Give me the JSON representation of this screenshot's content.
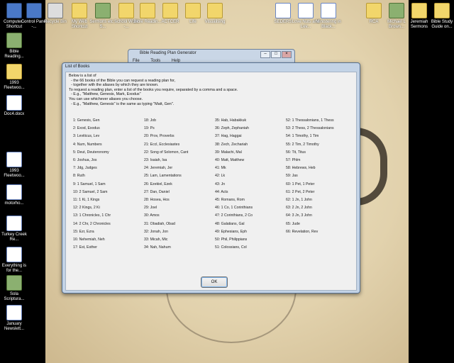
{
  "desktop": {
    "icons": [
      {
        "id": "computer",
        "label": "Computer - Shortcut",
        "kind": "pc"
      },
      {
        "id": "control-panel",
        "label": "Control Panel -...",
        "kind": "pc"
      },
      {
        "id": "recycle-bin",
        "label": "Recycle Bin",
        "kind": "app"
      },
      {
        "id": "my-web",
        "label": "My Web Shortcut",
        "kind": "folder"
      },
      {
        "id": "sermons",
        "label": "Sermons etc - S...",
        "kind": "img"
      },
      {
        "id": "school-work",
        "label": "School Work -...",
        "kind": "folder"
      },
      {
        "id": "bible-reading-top",
        "label": "Bible Readin...",
        "kind": "folder"
      },
      {
        "id": "actcer",
        "label": "ACTCER",
        "kind": "folder"
      },
      {
        "id": "life",
        "label": "Life",
        "kind": "folder"
      },
      {
        "id": "visualising",
        "label": "Visualising",
        "kind": "folder"
      },
      {
        "id": "seders",
        "label": "SEDERS",
        "kind": "mp3"
      },
      {
        "id": "love-nuts",
        "label": "Love Nuts and Lev...",
        "kind": "doc"
      },
      {
        "id": "ministering",
        "label": "Ministering in Black...",
        "kind": "mp3"
      },
      {
        "id": "rca",
        "label": "RCA",
        "kind": "folder"
      },
      {
        "id": "michael",
        "label": "Michael L Brown...",
        "kind": "img"
      },
      {
        "id": "jeremiah",
        "label": "Jeremiah Sermons",
        "kind": "folder"
      },
      {
        "id": "bible-study",
        "label": "Bible Study Guide on...",
        "kind": "folder"
      },
      {
        "id": "bible-reading-left",
        "label": "Bible Reading...",
        "kind": "img"
      },
      {
        "id": "fleetwood1",
        "label": "1993 Fleetwoo...",
        "kind": "folder"
      },
      {
        "id": "doc4",
        "label": "Doc4.docx",
        "kind": "doc"
      },
      {
        "id": "fleetwood2",
        "label": "1993 Fleetwoo...",
        "kind": "doc"
      },
      {
        "id": "motorho",
        "label": "motorho...",
        "kind": "doc"
      },
      {
        "id": "turkey",
        "label": "Turkey Creek Re...",
        "kind": "mp3"
      },
      {
        "id": "everything",
        "label": "Everything is for the...",
        "kind": "mp3"
      },
      {
        "id": "sola",
        "label": "Sola Scriptura...",
        "kind": "img"
      },
      {
        "id": "january",
        "label": "January Newslett...",
        "kind": "doc"
      }
    ]
  },
  "main_window": {
    "title": "Bible Reading Plan Generator",
    "menu": [
      "File",
      "Tools",
      "Help"
    ],
    "controls": {
      "minimize": "–",
      "maximize": "□",
      "close": "×"
    }
  },
  "dialog": {
    "title": "List of Books",
    "intro": "Below is a list of\n  - the 66 books of the Bible you can request a reading plan for,\n  - together with the aliases by which they are known.\nTo request a reading plan, enter a list of the books you require, separated by a comma and a space.\n  - E.g., \"Matthew, Genesis, Mark, Exodus\"\nYou can use whichever aliases you choose.\n  - E.g., \"Matthew, Genesis\" is the same as typing \"Matt, Gen\".",
    "ok_label": "OK",
    "books": [
      "1: Genesis, Gen",
      "2: Exod, Exodus",
      "3: Leviticus, Lev",
      "4: Num, Numbers",
      "5: Deut, Deuteronomy",
      "6: Joshua, Jos",
      "7: Jdg, Judges",
      "8: Ruth",
      "9: 1 Samuel, 1 Sam",
      "10: 2 Samuel, 2 Sam",
      "11: 1 Ki, 1 Kings",
      "12: 2 Kings, 2 Ki",
      "13: 1 Chronicles, 1 Chr",
      "14: 2 Chr, 2 Chronicles",
      "15: Ezr, Ezra",
      "16: Nehemiah, Neh",
      "17: Est, Esther",
      "18: Job",
      "19: Ps",
      "20: Prov, Proverbs",
      "21: Eccl, Ecclesiastes",
      "22: Song of Solomon, Cant",
      "23: Isaiah, Isa",
      "24: Jeremiah, Jer",
      "25: Lam, Lamentations",
      "26: Ezekiel, Ezek",
      "27: Dan, Daniel",
      "28: Hosea, Hos",
      "29: Joel",
      "30: Amos",
      "31: Obadiah, Obad",
      "32: Jonah, Jon",
      "33: Micah, Mic",
      "34: Nah, Nahum",
      "35: Hab, Habakkuk",
      "36: Zeph, Zephaniah",
      "37: Hag, Haggai",
      "38: Zech, Zechariah",
      "39: Malachi, Mal",
      "40: Matt, Matthew",
      "41: Mk",
      "42: Lk",
      "43: Jn",
      "44: Acts",
      "45: Romans, Rom",
      "46: 1 Co, 1 Corinthians",
      "47: 2 Corinthians, 2 Co",
      "48: Galatians, Gal",
      "49: Ephesians, Eph",
      "50: Phil, Philippians",
      "51: Colossians, Col",
      "52: 1 Thessalonians, 1 Thess",
      "53: 2 Thess, 2 Thessalonians",
      "54: 1 Timothy, 1 Tim",
      "55: 2 Tim, 2 Timothy",
      "56: Tit, Titus",
      "57: Phlm",
      "58: Hebrews, Heb",
      "59: Jas",
      "60: 1 Pet, 1 Peter",
      "61: 2 Pet, 2 Peter",
      "62: 1 Jn, 1 John",
      "63: 2 Jn, 2 John",
      "64: 3 Jn, 3 John",
      "65: Jude",
      "66: Revelation, Rev"
    ]
  }
}
